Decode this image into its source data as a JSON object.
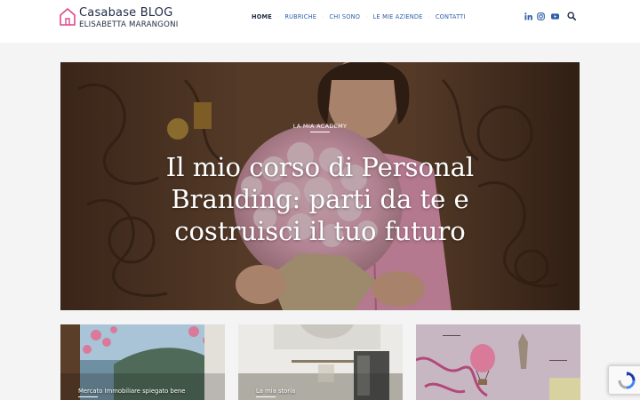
{
  "brand": {
    "title": "Casabase BLOG",
    "subtitle": "ELISABETTA MARANGONI",
    "accent_color": "#e0478c"
  },
  "nav": {
    "items": [
      {
        "label": "HOME",
        "active": true
      },
      {
        "label": "RUBRICHE",
        "active": false
      },
      {
        "label": "CHI SONO",
        "active": false
      },
      {
        "label": "LE MIE AZIENDE",
        "active": false
      },
      {
        "label": "CONTATTI",
        "active": false
      }
    ],
    "social_icons": [
      "linkedin-icon",
      "instagram-icon",
      "youtube-icon"
    ],
    "search_icon": "search-icon"
  },
  "hero": {
    "category": "LA MIA ACADEMY",
    "title": "Il mio corso di Personal Branding: parti da te e costruisci il tuo futuro"
  },
  "cards": [
    {
      "category": "Mercato Immobiliare spiegato bene"
    },
    {
      "category": "La mia storia"
    },
    {
      "category": ""
    }
  ],
  "recaptcha": {
    "icon": "recaptcha-icon"
  }
}
